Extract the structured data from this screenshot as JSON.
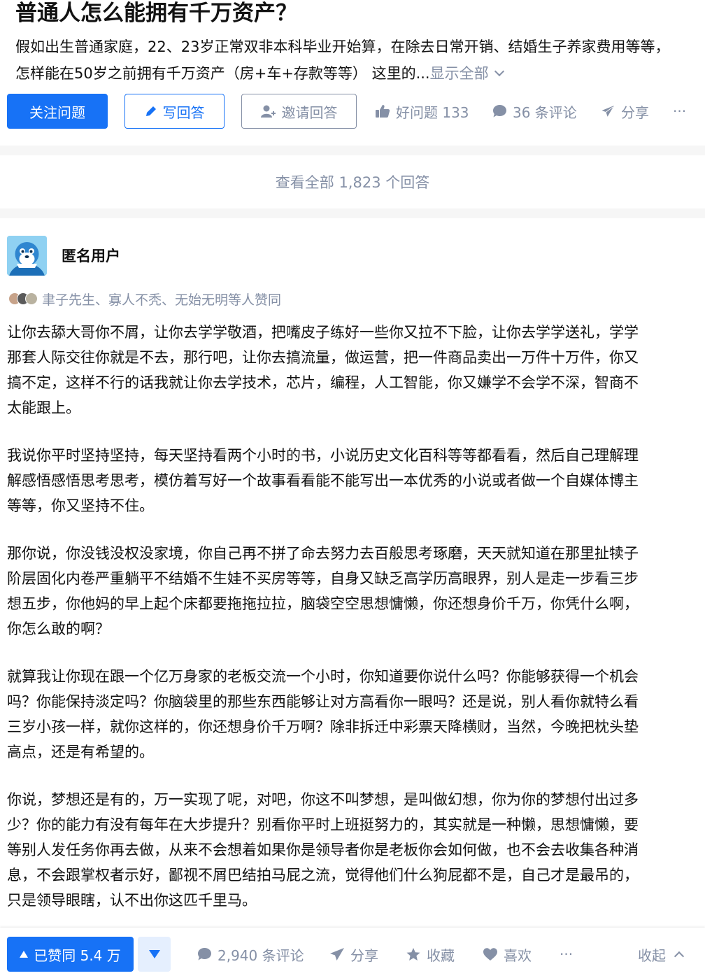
{
  "question": {
    "title": "普通人怎么能拥有千万资产？",
    "excerpt_line1": "假如出生普通家庭，22、23岁正常双非本科毕业开始算，在除去日常开销、结婚生子养家费用等等，",
    "excerpt_line2": "怎样能在50岁之前拥有千万资产（房+车+存款等等） 这里的...",
    "show_all": "显示全部"
  },
  "actions": {
    "follow": "关注问题",
    "write": "写回答",
    "invite": "邀请回答",
    "good_question": "好问题 133",
    "comments": "36 条评论",
    "share": "分享",
    "more": "···"
  },
  "view_all": "查看全部 1,823 个回答",
  "answer": {
    "author": "匿名用户",
    "voters": "聿子先生、寡人不秃、无始无明等人赞同",
    "paragraphs": [
      [
        "让你去舔大哥你不屑，让你去学学敬酒，把嘴皮子练好一些你又拉不下脸，让你去学学送礼，学学",
        "那套人际交往你就是不去，那行吧，让你去搞流量，做运营，把一件商品卖出一万件十万件，你又",
        "搞不定，这样不行的话我就让你去学技术，芯片，编程，人工智能，你又嫌学不会学不深，智商不",
        "太能跟上。"
      ],
      [
        "我说你平时坚持坚持，每天坚持看两个小时的书，小说历史文化百科等等都看看，然后自己理解理",
        "解感悟感悟思考思考，模仿着写好一个故事看看能不能写出一本优秀的小说或者做一个自媒体博主",
        "等等，你又坚持不住。"
      ],
      [
        "那你说，你没钱没权没家境，你自己再不拼了命去努力去百般思考琢磨，天天就知道在那里扯犊子",
        "阶层固化内卷严重躺平不结婚不生娃不买房等等，自身又缺乏高学历高眼界，别人是走一步看三步",
        "想五步，你他妈的早上起个床都要拖拖拉拉，脑袋空空思想慵懒，你还想身价千万，你凭什么啊，",
        "你怎么敢的啊？"
      ],
      [
        "就算我让你现在跟一个亿万身家的老板交流一个小时，你知道要你说什么吗？你能够获得一个机会",
        "吗？你能保持淡定吗？你脑袋里的那些东西能够让对方高看你一眼吗？还是说，别人看你就特么看",
        "三岁小孩一样，就你这样的，你还想身价千万啊？除非拆迁中彩票天降横财，当然，今晚把枕头垫",
        "高点，还是有希望的。"
      ],
      [
        "你说，梦想还是有的，万一实现了呢，对吧，你这不叫梦想，是叫做幻想，你为你的梦想付出过多",
        "少？你的能力有没有每年在大步提升？别看你平时上班挺努力的，其实就是一种懒，思想慵懒，要",
        "等别人发任务你再去做，从来不会想着如果你是领导者你是老板你会如何做，也不会去收集各种消",
        "息，不会跟掌权者示好，鄙视不屑巴结拍马屁之流，觉得他们什么狗屁都不是，自己才是最吊的，",
        "只是领导眼瞎，认不出你这匹千里马。"
      ]
    ]
  },
  "bottom_bar": {
    "upvoted": "已赞同 5.4 万",
    "comments": "2,940 条评论",
    "share": "分享",
    "collect": "收藏",
    "like": "喜欢",
    "more": "···",
    "collapse": "收起"
  },
  "colors": {
    "brand": "#1772f6",
    "muted": "#8590a6",
    "text": "#121212"
  }
}
